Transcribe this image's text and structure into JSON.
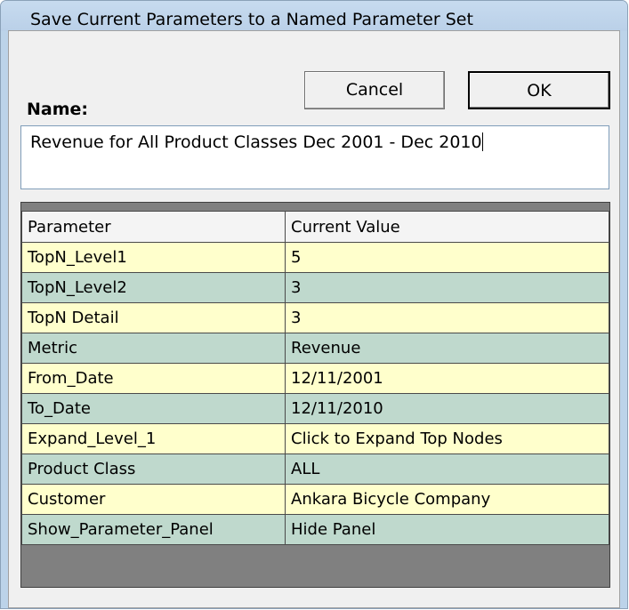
{
  "window": {
    "title": "Save Current Parameters to a Named Parameter Set"
  },
  "form": {
    "name_label": "Name:",
    "name_value": "Revenue for All Product Classes Dec 2001 - Dec 2010",
    "cancel_label": "Cancel",
    "ok_label": "OK"
  },
  "table": {
    "headers": [
      "Parameter",
      "Current Value"
    ],
    "rows": [
      {
        "parameter": "TopN_Level1",
        "value": "5"
      },
      {
        "parameter": "TopN_Level2",
        "value": "3"
      },
      {
        "parameter": "TopN Detail",
        "value": "3"
      },
      {
        "parameter": "Metric",
        "value": "Revenue"
      },
      {
        "parameter": "From_Date",
        "value": "12/11/2001"
      },
      {
        "parameter": "To_Date",
        "value": "12/11/2010"
      },
      {
        "parameter": "Expand_Level_1",
        "value": "Click to Expand Top Nodes"
      },
      {
        "parameter": "Product Class",
        "value": "ALL"
      },
      {
        "parameter": "Customer",
        "value": "Ankara Bicycle Company"
      },
      {
        "parameter": "Show_Parameter_Panel",
        "value": "Hide Panel"
      }
    ]
  },
  "colors": {
    "row_odd": "#ffffcc",
    "row_even": "#bfd9cd",
    "titlebar": "#bcd3e9"
  }
}
